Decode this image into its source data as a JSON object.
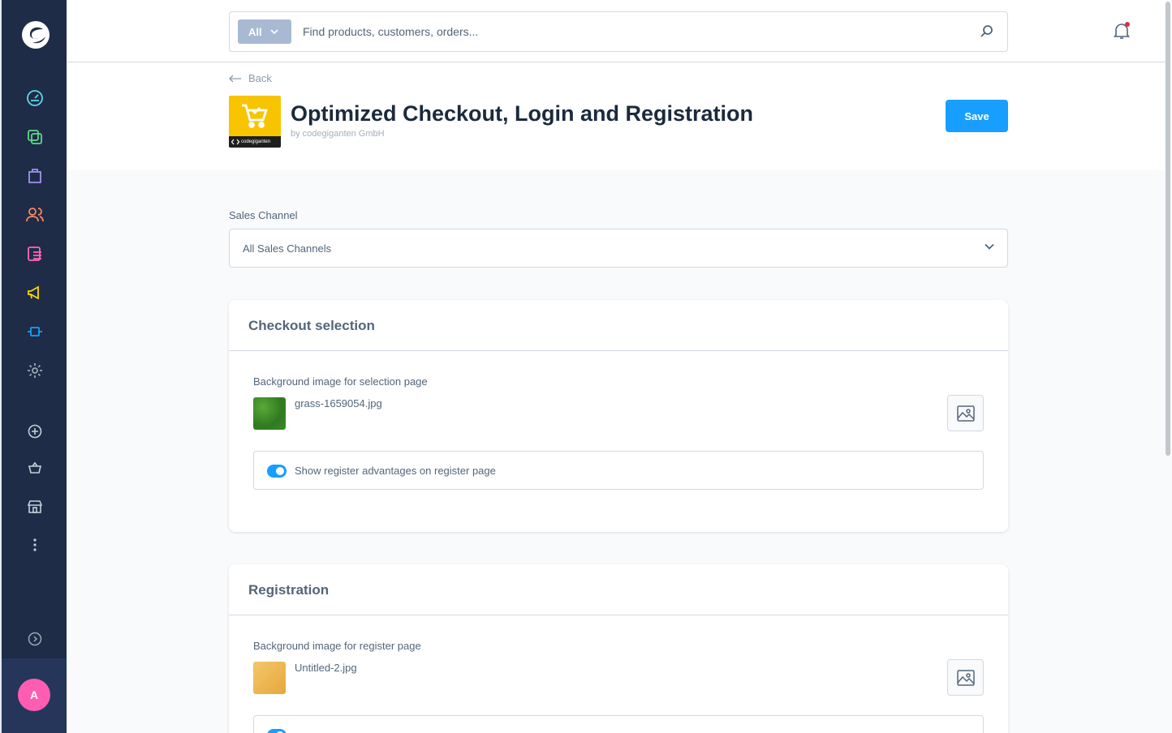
{
  "topbar": {
    "search_type": "All",
    "search_placeholder": "Find products, customers, orders..."
  },
  "header": {
    "back_label": "Back",
    "title": "Optimized Checkout, Login and Registration",
    "subtitle": "by codegiganten GmbH",
    "save_label": "Save",
    "plugin_brand": "codegiganten"
  },
  "sales_channel": {
    "label": "Sales Channel",
    "value": "All Sales Channels"
  },
  "checkout_card": {
    "title": "Checkout selection",
    "image_label": "Background image for selection page",
    "file_name": "grass-1659054.jpg",
    "toggle_label": "Show register advantages on register page",
    "toggle_on": true
  },
  "registration_card": {
    "title": "Registration",
    "image_label": "Background image for register page",
    "file_name": "Untitled-2.jpg"
  },
  "user": {
    "avatar_initial": "A"
  },
  "colors": {
    "sidebar_bg": "#1f2c47",
    "primary": "#189eff",
    "avatar": "#ff5db1"
  }
}
